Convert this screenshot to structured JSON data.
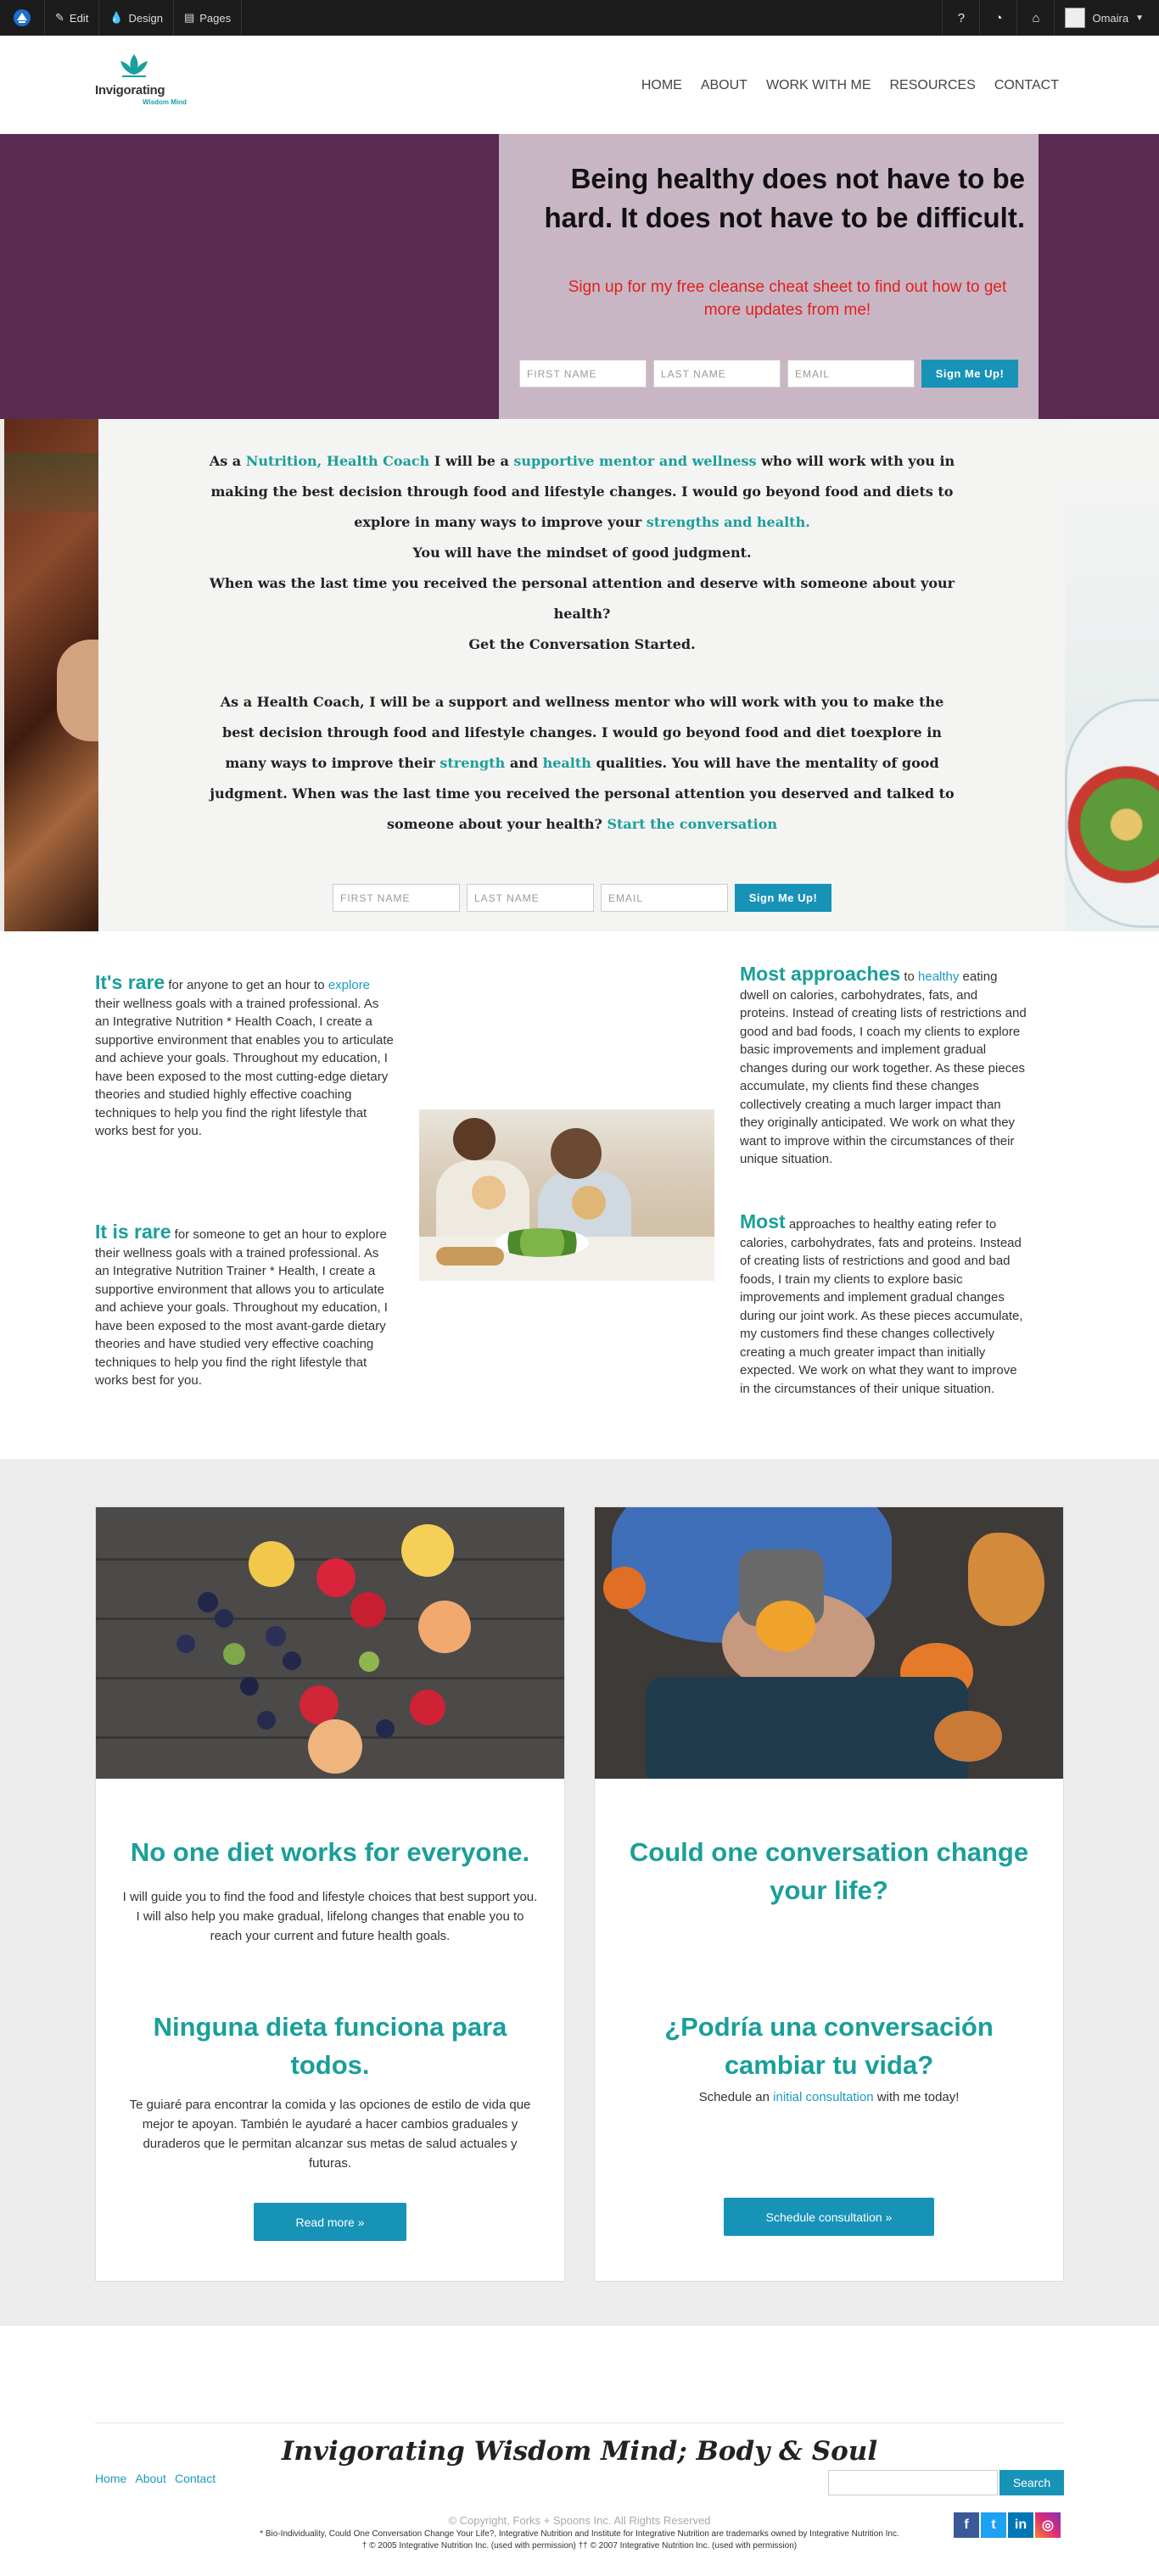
{
  "adminbar": {
    "edit": "Edit",
    "design": "Design",
    "pages": "Pages",
    "user": "Omaira"
  },
  "brand": {
    "name": "Invigorating",
    "sub": "Wisdom Mind"
  },
  "nav": {
    "items": [
      "HOME",
      "ABOUT",
      "WORK WITH ME",
      "RESOURCES",
      "CONTACT"
    ]
  },
  "hero": {
    "title": "Being healthy does not have to be hard. It does not have to be difficult.",
    "subtitle": "Sign up for my free cleanse cheat sheet to find out how to get more updates from me!",
    "form": {
      "first_name": "FIRST NAME",
      "last_name": "LAST NAME",
      "email": "EMAIL",
      "button": "Sign Me Up!"
    }
  },
  "intro": {
    "p1a": "As a ",
    "p1b": "Nutrition, Health Coach",
    "p1c": " I will be a ",
    "p1d": "supportive mentor and wellness",
    "p1e": " who will work with you in making the best decision through food and lifestyle changes. I would go beyond food and diets to explore in many ways to improve your ",
    "p1f": "strengths and health.",
    "p2": "You will have the mindset of good judgment.",
    "p3": "When was the last time you received the personal attention and deserve with someone about your health?",
    "p4": "Get the Conversation Started.",
    "p5a": "As a Health Coach, I will be a support and wellness mentor who will work with you to make the best decision through food and lifestyle changes. I would go beyond food and diet toexplore in many ways to improve their ",
    "p5b": "strength",
    "p5c": " and ",
    "p5d": "health",
    "p5e": " qualities. You will have the mentality of good judgment. When was the last time you received the personal attention you deserved and talked to someone about your health? ",
    "p5f": "Start the conversation",
    "form": {
      "first_name": "FIRST NAME",
      "last_name": "LAST NAME",
      "email": "EMAIL",
      "button": "Sign Me Up!"
    }
  },
  "features": {
    "left1_head": "It's rare",
    "left1_a": " for anyone to get an hour to ",
    "left1_link": "explore",
    "left1_b": " their wellness goals with a trained professional. As an Integrative Nutrition * Health Coach, I create a supportive environment that enables you to articulate and achieve your goals. Throughout my education, I have been exposed to the most cutting-edge dietary theories and studied highly effective coaching techniques to help you find the right lifestyle that works best for you.",
    "left2_head": "It is rare",
    "left2_body": " for someone to get an hour to explore their wellness goals with a trained professional. As an Integrative Nutrition Trainer * Health, I create a supportive environment that allows you to articulate and achieve your goals. Throughout my education, I have been exposed to the most avant-garde dietary theories and have studied very effective coaching techniques to help you find the right lifestyle that works best for you.",
    "right1_head": "Most approaches",
    "right1_a": " to ",
    "right1_link": "healthy",
    "right1_b": " eating dwell on calories, carbohydrates, fats, and proteins. Instead of creating lists of restrictions and good and bad foods, I coach my clients to explore basic improvements and implement gradual changes during our work together. As these pieces accumulate, my clients find these changes collectively creating a much larger impact than they originally anticipated. We work on what they want to improve within the circumstances of their unique situation.",
    "right2_head": "Most",
    "right2_body": " approaches to healthy eating refer to calories, carbohydrates, fats and proteins. Instead of creating lists of restrictions and good and bad foods, I train my clients to explore basic improvements and implement gradual changes during our joint work. As these pieces accumulate, my customers find these changes collectively creating a much greater impact than initially expected. We work on what they want to improve in the circumstances of their unique situation."
  },
  "cards": {
    "left": {
      "title": "No one diet works for everyone.",
      "body": "I will guide you to find the food and lifestyle choices that best support you. I will also help you make gradual, lifelong changes that enable you to reach your current and future health goals.",
      "title_es": "Ninguna dieta funciona para todos.",
      "body_es": "Te guiaré para encontrar la comida y las opciones de estilo de vida que mejor te apoyan. También le ayudaré a hacer cambios graduales y duraderos que le permitan alcanzar sus metas de salud actuales y futuras.",
      "button": "Read more »"
    },
    "right": {
      "title": "Could one conversation change your life?",
      "title_es": "¿Podría una conversación cambiar tu vida?",
      "body_a": "Schedule an ",
      "body_link": "initial consultation",
      "body_b": " with me today!",
      "button": "Schedule consultation »"
    }
  },
  "footer": {
    "title": "Invigorating Wisdom Mind; Body & Soul",
    "links": [
      "Home",
      "About",
      "Contact"
    ],
    "search_button": "Search",
    "copyright": "© Copyright, Forks + Spoons Inc. All Rights Reserved",
    "legal1": "* Bio-Individuality, Could One Conversation Change Your Life?, Integrative Nutrition and Institute for Integrative Nutrition are trademarks owned by Integrative Nutrition Inc.",
    "legal2": "† © 2005 Integrative Nutrition Inc. (used with permission) †† © 2007 Integrative Nutrition Inc. (used with permission)"
  },
  "colors": {
    "teal": "#1a9f9a",
    "button_blue": "#1793b8",
    "hero_purple": "#5a2b52",
    "hero_box": "#c9b6c4",
    "red_text": "#e0201e"
  }
}
